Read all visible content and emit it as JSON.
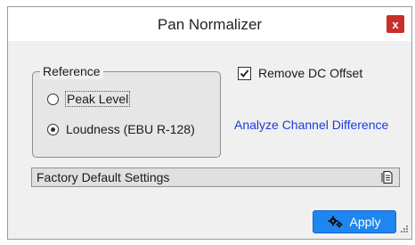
{
  "window": {
    "title": "Pan Normalizer",
    "close_label": "x"
  },
  "reference": {
    "legend": "Reference",
    "options": [
      {
        "label": "Peak Level",
        "selected": false
      },
      {
        "label": "Loudness (EBU R-128)",
        "selected": true
      }
    ]
  },
  "remove_dc": {
    "label": "Remove DC Offset",
    "checked": true
  },
  "analyze_link": "Analyze Channel Difference",
  "preset": {
    "value": "Factory Default Settings",
    "icon": "preset-menu-icon"
  },
  "apply": {
    "label": "Apply",
    "icon": "gears-icon",
    "color": "#1f86f0"
  },
  "colors": {
    "close": "#c9302c",
    "link": "#1a3be0",
    "background": "#f0f0f0"
  }
}
